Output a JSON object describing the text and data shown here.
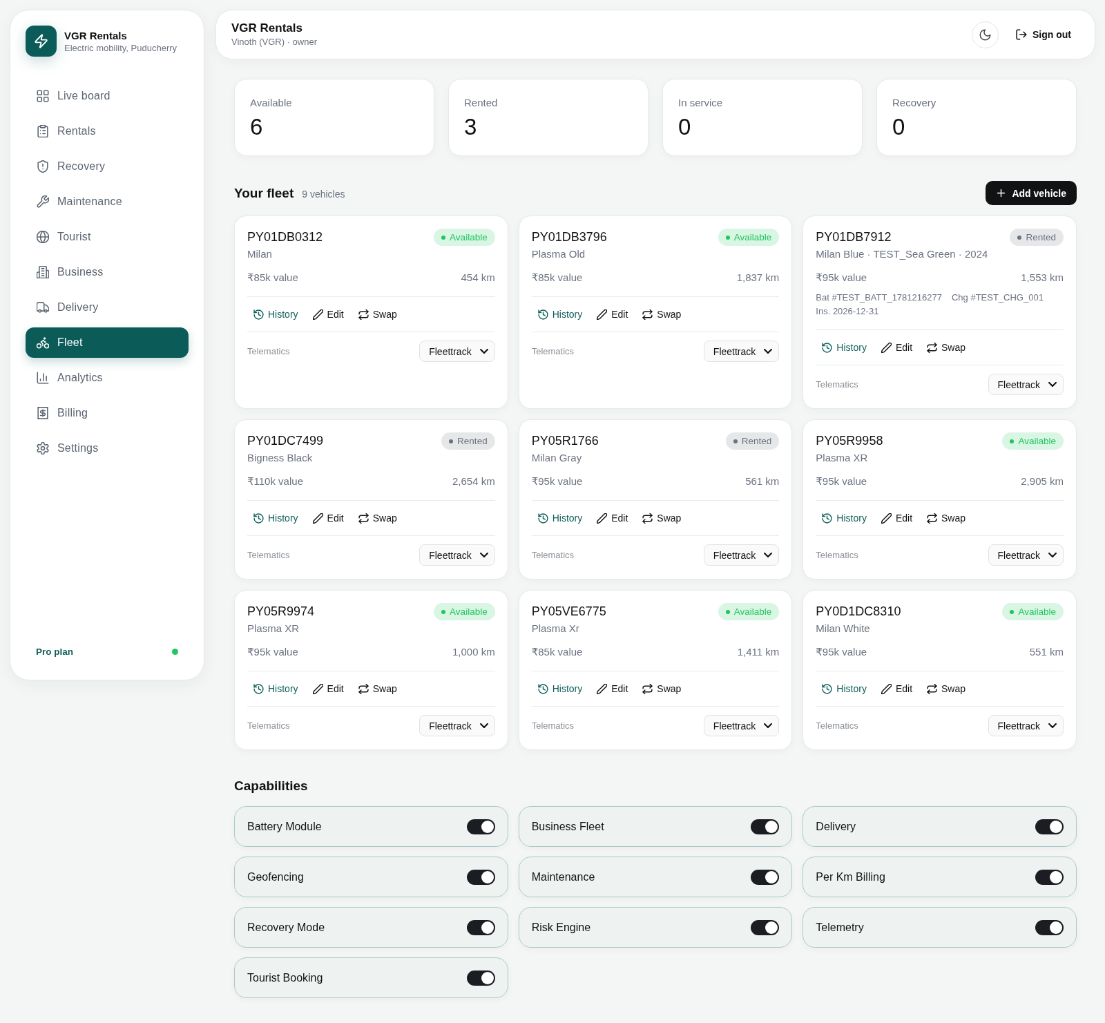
{
  "sidebar": {
    "brand": {
      "name": "VGR Rentals",
      "tagline": "Electric mobility, Puducherry"
    },
    "items": [
      {
        "label": "Live board",
        "selected": false
      },
      {
        "label": "Rentals",
        "selected": false
      },
      {
        "label": "Recovery",
        "selected": false
      },
      {
        "label": "Maintenance",
        "selected": false
      },
      {
        "label": "Tourist",
        "selected": false
      },
      {
        "label": "Business",
        "selected": false
      },
      {
        "label": "Delivery",
        "selected": false
      },
      {
        "label": "Fleet",
        "selected": true
      },
      {
        "label": "Analytics",
        "selected": false
      },
      {
        "label": "Billing",
        "selected": false
      },
      {
        "label": "Settings",
        "selected": false
      }
    ],
    "plan": {
      "label": "Pro plan",
      "color": "#22c55e"
    }
  },
  "header": {
    "title": "VGR Rentals",
    "subtitle": "Vinoth (VGR) · owner",
    "sign_out": "Sign out"
  },
  "stats": [
    {
      "label": "Available",
      "value": "6"
    },
    {
      "label": "Rented",
      "value": "3"
    },
    {
      "label": "In service",
      "value": "0"
    },
    {
      "label": "Recovery",
      "value": "0"
    }
  ],
  "fleet": {
    "title": "Your fleet",
    "count": "9 vehicles",
    "add_button": "Add vehicle",
    "vehicles": [
      {
        "plate": "PY01DB0312",
        "model": "Milan",
        "status": {
          "label": "Available",
          "color": "#22c55e"
        },
        "value": "₹85k value",
        "distance": "454 km",
        "actions": [
          {
            "kind": "history",
            "label": "History"
          },
          {
            "kind": "edit",
            "label": "Edit"
          },
          {
            "kind": "swap",
            "label": "Swap"
          }
        ],
        "telematics": {
          "label": "Telematics",
          "provider": "Fleettrack"
        }
      },
      {
        "plate": "PY01DB3796",
        "model": "Plasma Old",
        "status": {
          "label": "Available",
          "color": "#22c55e"
        },
        "value": "₹85k value",
        "distance": "1,837 km",
        "actions": [
          {
            "kind": "history",
            "label": "History"
          },
          {
            "kind": "edit",
            "label": "Edit"
          },
          {
            "kind": "swap",
            "label": "Swap"
          }
        ],
        "telematics": {
          "label": "Telematics",
          "provider": "Fleettrack"
        }
      },
      {
        "plate": "PY01DB7912",
        "model": "Milan Blue · TEST_Sea Green · 2024",
        "status": {
          "label": "Rented",
          "color": "#6b7280"
        },
        "value": "₹95k value",
        "distance": "1,553 km",
        "details": [
          "Bat #TEST_BATT_1781216277",
          "Chg #TEST_CHG_001",
          "Ins. 2026-12-31"
        ],
        "actions": [
          {
            "kind": "history",
            "label": "History"
          },
          {
            "kind": "edit",
            "label": "Edit"
          },
          {
            "kind": "swap",
            "label": "Swap"
          }
        ],
        "telematics": {
          "label": "Telematics",
          "provider": "Fleettrack"
        }
      },
      {
        "plate": "PY01DC7499",
        "model": "Bigness Black",
        "status": {
          "label": "Rented",
          "color": "#6b7280"
        },
        "value": "₹110k value",
        "distance": "2,654 km",
        "actions": [
          {
            "kind": "history",
            "label": "History"
          },
          {
            "kind": "edit",
            "label": "Edit"
          },
          {
            "kind": "swap",
            "label": "Swap"
          }
        ],
        "telematics": {
          "label": "Telematics",
          "provider": "Fleettrack"
        }
      },
      {
        "plate": "PY05R1766",
        "model": "Milan Gray",
        "status": {
          "label": "Rented",
          "color": "#6b7280"
        },
        "value": "₹95k value",
        "distance": "561 km",
        "actions": [
          {
            "kind": "history",
            "label": "History"
          },
          {
            "kind": "edit",
            "label": "Edit"
          },
          {
            "kind": "swap",
            "label": "Swap"
          }
        ],
        "telematics": {
          "label": "Telematics",
          "provider": "Fleettrack"
        }
      },
      {
        "plate": "PY05R9958",
        "model": "Plasma XR",
        "status": {
          "label": "Available",
          "color": "#22c55e"
        },
        "value": "₹95k value",
        "distance": "2,905 km",
        "actions": [
          {
            "kind": "history",
            "label": "History"
          },
          {
            "kind": "edit",
            "label": "Edit"
          },
          {
            "kind": "swap",
            "label": "Swap"
          }
        ],
        "telematics": {
          "label": "Telematics",
          "provider": "Fleettrack"
        }
      },
      {
        "plate": "PY05R9974",
        "model": "Plasma XR",
        "status": {
          "label": "Available",
          "color": "#22c55e"
        },
        "value": "₹95k value",
        "distance": "1,000 km",
        "actions": [
          {
            "kind": "history",
            "label": "History"
          },
          {
            "kind": "edit",
            "label": "Edit"
          },
          {
            "kind": "swap",
            "label": "Swap"
          }
        ],
        "telematics": {
          "label": "Telematics",
          "provider": "Fleettrack"
        }
      },
      {
        "plate": "PY05VE6775",
        "model": "Plasma Xr",
        "status": {
          "label": "Available",
          "color": "#22c55e"
        },
        "value": "₹85k value",
        "distance": "1,411 km",
        "actions": [
          {
            "kind": "history",
            "label": "History"
          },
          {
            "kind": "edit",
            "label": "Edit"
          },
          {
            "kind": "swap",
            "label": "Swap"
          }
        ],
        "telematics": {
          "label": "Telematics",
          "provider": "Fleettrack"
        }
      },
      {
        "plate": "PY0D1DC8310",
        "model": "Milan White",
        "status": {
          "label": "Available",
          "color": "#22c55e"
        },
        "value": "₹95k value",
        "distance": "551 km",
        "actions": [
          {
            "kind": "history",
            "label": "History"
          },
          {
            "kind": "edit",
            "label": "Edit"
          },
          {
            "kind": "swap",
            "label": "Swap"
          }
        ],
        "telematics": {
          "label": "Telematics",
          "provider": "Fleettrack"
        }
      }
    ]
  },
  "capabilities": {
    "title": "Capabilities",
    "items": [
      {
        "label": "Battery Module",
        "on": true
      },
      {
        "label": "Business Fleet",
        "on": true
      },
      {
        "label": "Delivery",
        "on": true
      },
      {
        "label": "Geofencing",
        "on": true
      },
      {
        "label": "Maintenance",
        "on": true
      },
      {
        "label": "Per Km Billing",
        "on": true
      },
      {
        "label": "Recovery Mode",
        "on": true
      },
      {
        "label": "Risk Engine",
        "on": true
      },
      {
        "label": "Telemetry",
        "on": true
      },
      {
        "label": "Tourist Booking",
        "on": true
      }
    ]
  }
}
